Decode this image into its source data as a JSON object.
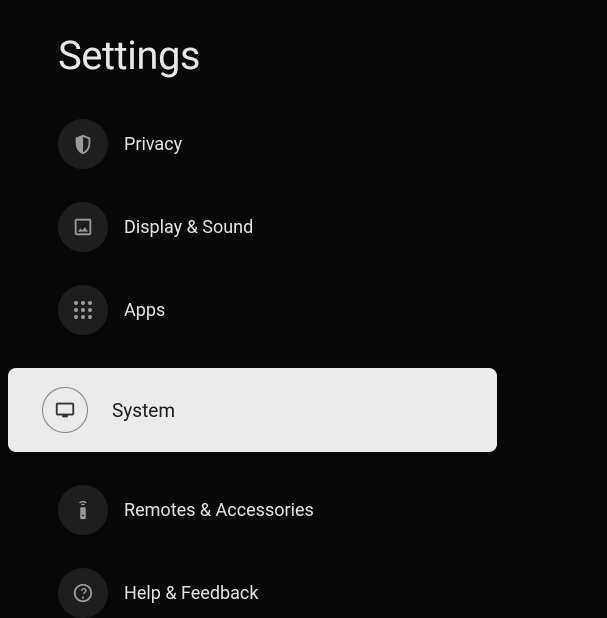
{
  "page_title": "Settings",
  "items": [
    {
      "label": "Privacy",
      "icon": "shield-icon",
      "selected": false
    },
    {
      "label": "Display & Sound",
      "icon": "image-icon",
      "selected": false
    },
    {
      "label": "Apps",
      "icon": "apps-grid-icon",
      "selected": false
    },
    {
      "label": "System",
      "icon": "monitor-icon",
      "selected": true
    },
    {
      "label": "Remotes & Accessories",
      "icon": "remote-icon",
      "selected": false
    },
    {
      "label": "Help & Feedback",
      "icon": "help-icon",
      "selected": false
    }
  ]
}
